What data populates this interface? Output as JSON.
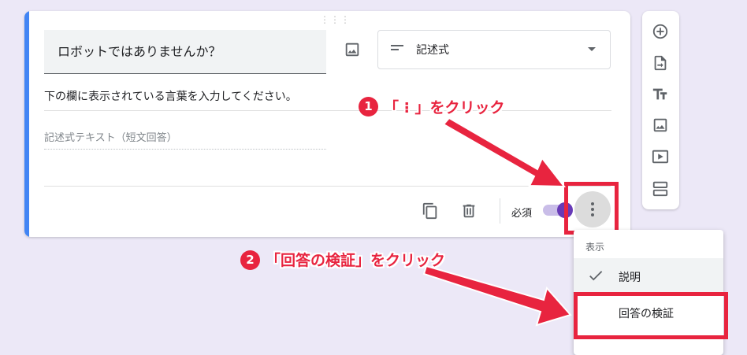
{
  "question": {
    "title": "ロボットではありませんか？",
    "description": "下の欄に表示されている言葉を入力してください。",
    "answer_placeholder": "記述式テキスト（短文回答）",
    "type_label": "記述式",
    "required_label": "必須",
    "required": true
  },
  "menu": {
    "section_label": "表示",
    "items": [
      {
        "label": "説明",
        "checked": true
      },
      {
        "label": "回答の検証",
        "checked": false
      }
    ]
  },
  "annotations": {
    "step1_number": "1",
    "step1_text": "「 ⁝ 」をクリック",
    "step2_number": "2",
    "step2_text": "「回答の検証」をクリック"
  },
  "colors": {
    "accent": "#4285f4",
    "toggle": "#673ab7",
    "annotation": "#e8243f",
    "background": "#ece8f7"
  },
  "icons": {
    "toolbar": [
      "add-question-icon",
      "import-questions-icon",
      "add-title-icon",
      "add-image-icon",
      "add-video-icon",
      "add-section-icon"
    ]
  }
}
